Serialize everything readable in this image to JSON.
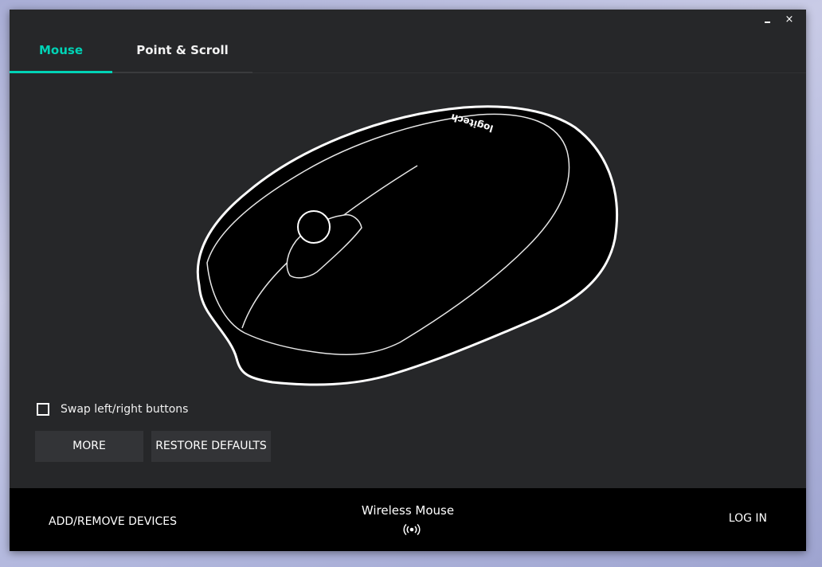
{
  "window": {
    "minimize_label": "_",
    "close_label": "×"
  },
  "tabs": [
    {
      "label": "Mouse",
      "active": true
    },
    {
      "label": "Point & Scroll",
      "active": false
    }
  ],
  "mouse_image": {
    "brand_text": "logitech"
  },
  "settings": {
    "swap_label": "Swap left/right buttons",
    "swap_checked": false,
    "more_label": "MORE",
    "restore_label": "RESTORE DEFAULTS"
  },
  "footer": {
    "add_remove_label": "ADD/REMOVE DEVICES",
    "device_name": "Wireless Mouse",
    "login_label": "LOG IN"
  },
  "colors": {
    "accent": "#00d3b6",
    "window_bg": "#262729",
    "footer_bg": "#000000",
    "button_bg": "#333437"
  }
}
